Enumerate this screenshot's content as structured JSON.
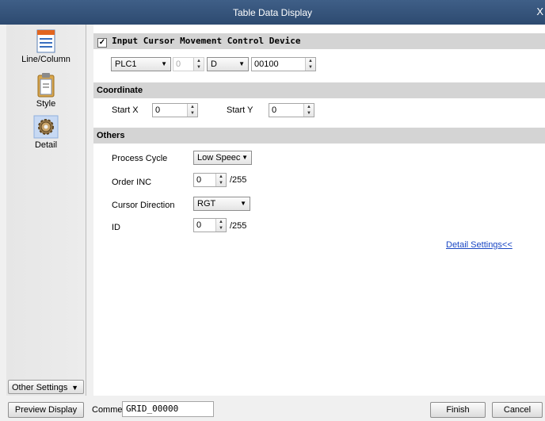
{
  "window": {
    "title": "Table Data Display",
    "close": "X"
  },
  "sidebar": {
    "items": [
      {
        "label": "Line/Column",
        "icon": "table-grid-icon"
      },
      {
        "label": "Style",
        "icon": "clipboard-style-icon"
      },
      {
        "label": "Detail",
        "icon": "gear-icon",
        "selected": true
      }
    ],
    "other_settings": "Other Settings"
  },
  "cursor_device": {
    "checkbox_label": "Input Cursor Movement Control Device",
    "checked": true,
    "plc": "PLC1",
    "station": "0",
    "device_type": "D",
    "address": "00100"
  },
  "coordinate": {
    "header": "Coordinate",
    "start_x_label": "Start X",
    "start_x": "0",
    "start_y_label": "Start Y",
    "start_y": "0"
  },
  "others": {
    "header": "Others",
    "process_cycle_label": "Process Cycle",
    "process_cycle": "Low Speec",
    "order_inc_label": "Order INC",
    "order_inc": "0",
    "order_inc_max": "/255",
    "cursor_direction_label": "Cursor Direction",
    "cursor_direction": "RGT",
    "id_label": "ID",
    "id": "0",
    "id_max": "/255",
    "detail_settings": "Detail Settings<<"
  },
  "footer": {
    "preview": "Preview Display",
    "comment_label": "Comme",
    "comment": "GRID_00000",
    "finish": "Finish",
    "cancel": "Cancel"
  }
}
